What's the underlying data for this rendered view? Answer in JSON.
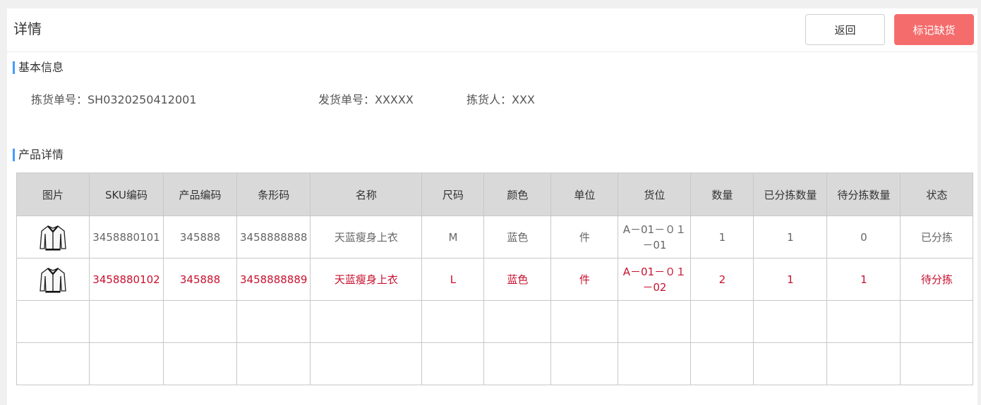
{
  "header": {
    "title": "详情",
    "back_label": "返回",
    "mark_label": "标记缺货"
  },
  "basic_info": {
    "section_title": "基本信息",
    "pick_no": "拣货单号：SH0320250412001",
    "ship_no": "发货单号：XXXXX",
    "picker": "拣货人：XXX"
  },
  "product_detail": {
    "section_title": "产品详情",
    "columns": [
      "图片",
      "SKU编码",
      "产品编码",
      "条形码",
      "名称",
      "尺码",
      "颜色",
      "单位",
      "货位",
      "数量",
      "已分拣数量",
      "待分拣数量",
      "状态"
    ],
    "rows": [
      {
        "image": "cardigan-thumbnail",
        "sku": "3458880101",
        "product_code": "345888",
        "barcode": "3458888888",
        "name": "天蓝瘦身上衣",
        "size": "M",
        "color": "蓝色",
        "unit": "件",
        "location": "A－01－０１－01",
        "qty": "1",
        "sorted_qty": "1",
        "pending_qty": "0",
        "status": "已分拣"
      },
      {
        "image": "cardigan-thumbnail",
        "sku": "3458880102",
        "product_code": "345888",
        "barcode": "3458888889",
        "name": "天蓝瘦身上衣",
        "size": "L",
        "color": "蓝色",
        "unit": "件",
        "location": "A－01－０１－02",
        "qty": "2",
        "sorted_qty": "1",
        "pending_qty": "1",
        "status": "待分拣"
      }
    ]
  },
  "colors": {
    "accent_bar": "#409eff",
    "mark_button": "#f56c6c",
    "pending_text": "#c8102e",
    "header_cell": "#d9d9d9"
  }
}
